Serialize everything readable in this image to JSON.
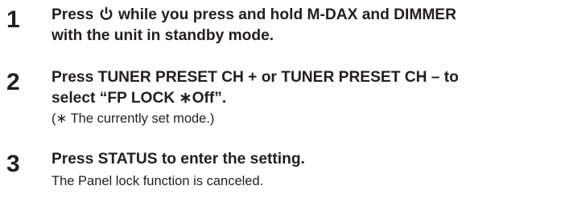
{
  "steps": [
    {
      "number": "1",
      "line1_before_icon": "Press ",
      "icon": "power-icon",
      "line1_after_icon": " while you press and hold M-DAX and DIMMER",
      "line2": "with the unit in standby mode."
    },
    {
      "number": "2",
      "line1": "Press TUNER PRESET CH + or TUNER PRESET CH – to",
      "line2": "select “FP LOCK ∗Off”.",
      "note": "(∗ The currently set mode.)"
    },
    {
      "number": "3",
      "line1": "Press STATUS to enter the setting.",
      "note": "The Panel lock function is canceled."
    }
  ]
}
